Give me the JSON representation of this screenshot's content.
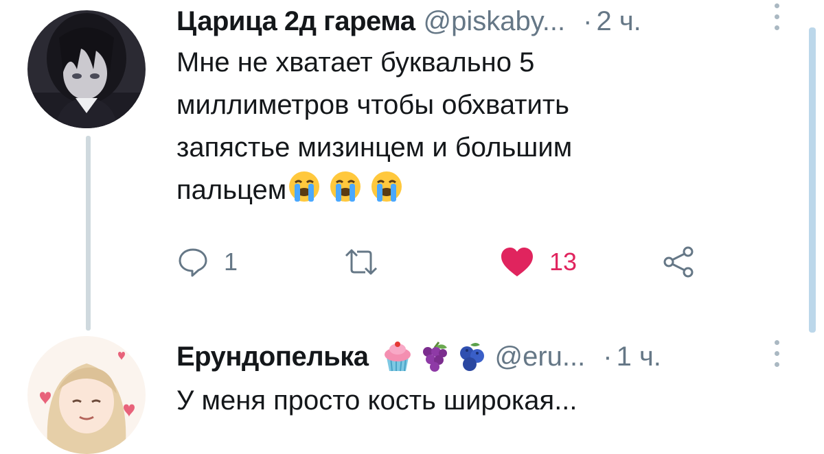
{
  "tweet_1": {
    "author_name": "Царица 2д гарема",
    "handle": "@piskaby...",
    "separator": "·",
    "time": "2 ч.",
    "text_lines": [
      "Мне не хватает буквально 5",
      "миллиметров чтобы обхватить",
      "запястье мизинцем и большим",
      "пальцем"
    ],
    "emojis": [
      "loudly-crying-face",
      "loudly-crying-face",
      "loudly-crying-face"
    ],
    "actions": {
      "reply_count": "1",
      "retweet_count": "",
      "like_count": "13",
      "liked": true
    }
  },
  "tweet_2": {
    "author_name": "Ерундопелька",
    "name_emojis": [
      "cupcake",
      "grapes",
      "blueberries"
    ],
    "handle": "@eru...",
    "separator": "·",
    "time": "1 ч.",
    "text": "У меня просто кость широкая..."
  },
  "colors": {
    "text": "#14171a",
    "secondary": "#657786",
    "like": "#e0245e",
    "thread_line": "#cfd9de",
    "scrollbar": "#bcd7ea"
  }
}
